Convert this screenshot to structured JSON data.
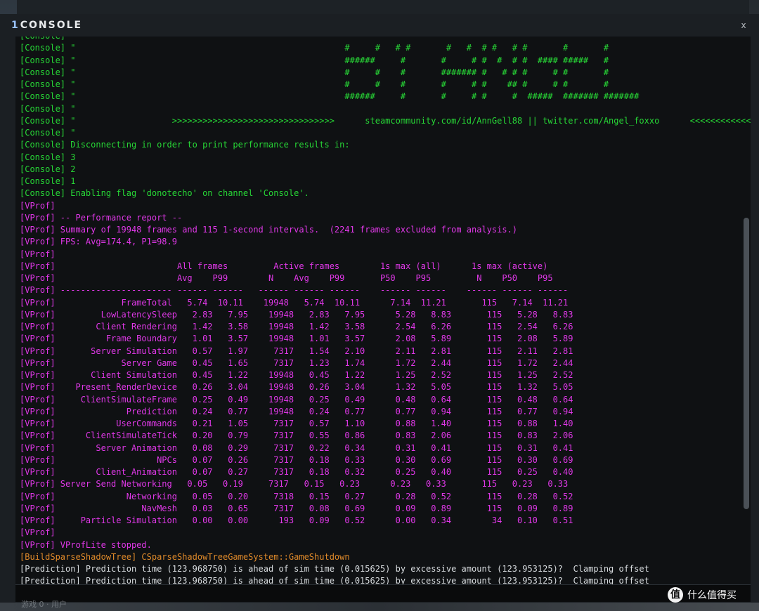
{
  "window": {
    "title_number": "1",
    "title": "CONSOLE",
    "close_glyph": "x"
  },
  "watermark": {
    "logo_glyph": "值",
    "text": "什么值得买"
  },
  "bottom_left_text": "游戏 0 · 用户",
  "colors": {
    "console_green": "#27d636",
    "vprof_magenta": "#e038e8",
    "warning_orange": "#e08a2a",
    "prediction_white": "#d8dcdf"
  },
  "log_lines": [
    {
      "kind": "console",
      "text": "[Console] \""
    },
    {
      "kind": "console",
      "text": "[Console] \"                                                     #     #   # #       #   #  # #   # #       #       #"
    },
    {
      "kind": "console",
      "text": "[Console] \"                                                     ######     #       #     # #  #  # #  #### #####   #"
    },
    {
      "kind": "console",
      "text": "[Console] \"                                                     #     #    #       ####### #   # # #     # #       #"
    },
    {
      "kind": "console",
      "text": "[Console] \"                                                     #     #    #       #     # #    ## #     # #       #"
    },
    {
      "kind": "console",
      "text": "[Console] \"                                                     ######     #       #     # #     #  #####  ####### #######"
    },
    {
      "kind": "console",
      "text": "[Console] \""
    },
    {
      "kind": "console",
      "text": "[Console] \"                   >>>>>>>>>>>>>>>>>>>>>>>>>>>>>>>>      steamcommunity.com/id/AnnGell88 || twitter.com/Angel_foxxo      <<<<<<<<<<<<<<<<<"
    },
    {
      "kind": "console",
      "text": "[Console] \""
    },
    {
      "kind": "console",
      "text": "[Console] Disconnecting in order to print performance results in:"
    },
    {
      "kind": "console",
      "text": "[Console] 3"
    },
    {
      "kind": "console",
      "text": "[Console] 2"
    },
    {
      "kind": "console",
      "text": "[Console] 1"
    },
    {
      "kind": "console",
      "text": "[Console] Enabling flag 'donotecho' on channel 'Console'."
    },
    {
      "kind": "vprof",
      "text": "[VProf]"
    },
    {
      "kind": "vprof",
      "text": "[VProf] -- Performance report --"
    },
    {
      "kind": "vprof",
      "text": "[VProf] Summary of 19948 frames and 115 1-second intervals.  (2241 frames excluded from analysis.)"
    },
    {
      "kind": "vprof",
      "text": "[VProf] FPS: Avg=174.4, P1=98.9"
    },
    {
      "kind": "vprof",
      "text": "[VProf]"
    },
    {
      "kind": "vprof",
      "text": "[VProf]                        All frames         Active frames        1s max (all)      1s max (active)"
    },
    {
      "kind": "vprof",
      "text": "[VProf]                        Avg    P99        N    Avg    P99       P50    P95         N    P50    P95"
    },
    {
      "kind": "vprof",
      "text": "[VProf] ---------------------- ------ ------   ------ ------ ------    ------ ------    ------ ------ ------"
    },
    {
      "kind": "vprof",
      "text": "[VProf]             FrameTotal   5.74  10.11    19948   5.74  10.11      7.14  11.21       115   7.14  11.21"
    },
    {
      "kind": "vprof",
      "text": "[VProf]         LowLatencySleep   2.83   7.95    19948   2.83   7.95      5.28   8.83       115   5.28   8.83"
    },
    {
      "kind": "vprof",
      "text": "[VProf]        Client Rendering   1.42   3.58    19948   1.42   3.58      2.54   6.26       115   2.54   6.26"
    },
    {
      "kind": "vprof",
      "text": "[VProf]          Frame Boundary   1.01   3.57    19948   1.01   3.57      2.08   5.89       115   2.08   5.89"
    },
    {
      "kind": "vprof",
      "text": "[VProf]       Server Simulation   0.57   1.97     7317   1.54   2.10      2.11   2.81       115   2.11   2.81"
    },
    {
      "kind": "vprof",
      "text": "[VProf]             Server Game   0.45   1.65     7317   1.23   1.74      1.72   2.44       115   1.72   2.44"
    },
    {
      "kind": "vprof",
      "text": "[VProf]       Client Simulation   0.45   1.22    19948   0.45   1.22      1.25   2.52       115   1.25   2.52"
    },
    {
      "kind": "vprof",
      "text": "[VProf]    Present_RenderDevice   0.26   3.04    19948   0.26   3.04      1.32   5.05       115   1.32   5.05"
    },
    {
      "kind": "vprof",
      "text": "[VProf]     ClientSimulateFrame   0.25   0.49    19948   0.25   0.49      0.48   0.64       115   0.48   0.64"
    },
    {
      "kind": "vprof",
      "text": "[VProf]              Prediction   0.24   0.77    19948   0.24   0.77      0.77   0.94       115   0.77   0.94"
    },
    {
      "kind": "vprof",
      "text": "[VProf]            UserCommands   0.21   1.05     7317   0.57   1.10      0.88   1.40       115   0.88   1.40"
    },
    {
      "kind": "vprof",
      "text": "[VProf]      ClientSimulateTick   0.20   0.79     7317   0.55   0.86      0.83   2.06       115   0.83   2.06"
    },
    {
      "kind": "vprof",
      "text": "[VProf]        Server Animation   0.08   0.29     7317   0.22   0.34      0.31   0.41       115   0.31   0.41"
    },
    {
      "kind": "vprof",
      "text": "[VProf]                    NPCs   0.07   0.26     7317   0.18   0.33      0.30   0.69       115   0.30   0.69"
    },
    {
      "kind": "vprof",
      "text": "[VProf]        Client_Animation   0.07   0.27     7317   0.18   0.32      0.25   0.40       115   0.25   0.40"
    },
    {
      "kind": "vprof",
      "text": "[VProf] Server Send Networking   0.05   0.19     7317   0.15   0.23      0.23   0.33       115   0.23   0.33"
    },
    {
      "kind": "vprof",
      "text": "[VProf]              Networking   0.05   0.20     7318   0.15   0.27      0.28   0.52       115   0.28   0.52"
    },
    {
      "kind": "vprof",
      "text": "[VProf]                 NavMesh   0.03   0.65     7317   0.08   0.69      0.09   0.89       115   0.09   0.89"
    },
    {
      "kind": "vprof",
      "text": "[VProf]     Particle Simulation   0.00   0.00      193   0.09   0.52      0.00   0.34        34   0.10   0.51"
    },
    {
      "kind": "vprof",
      "text": "[VProf]"
    },
    {
      "kind": "vprof",
      "text": "[VProf] VProfLite stopped."
    },
    {
      "kind": "orange",
      "text": "[BuildSparseShadowTree] CSparseShadowTreeGameSystem::GameShutdown"
    },
    {
      "kind": "pred",
      "text": "[Prediction] Prediction time (123.968750) is ahead of sim time (0.015625) by excessive amount (123.953125)?  Clamping offset"
    },
    {
      "kind": "pred",
      "text": "[Prediction] Prediction time (123.968750) is ahead of sim time (0.015625) by excessive amount (123.953125)?  Clamping offset"
    }
  ],
  "input": {
    "value": "",
    "placeholder": ""
  }
}
